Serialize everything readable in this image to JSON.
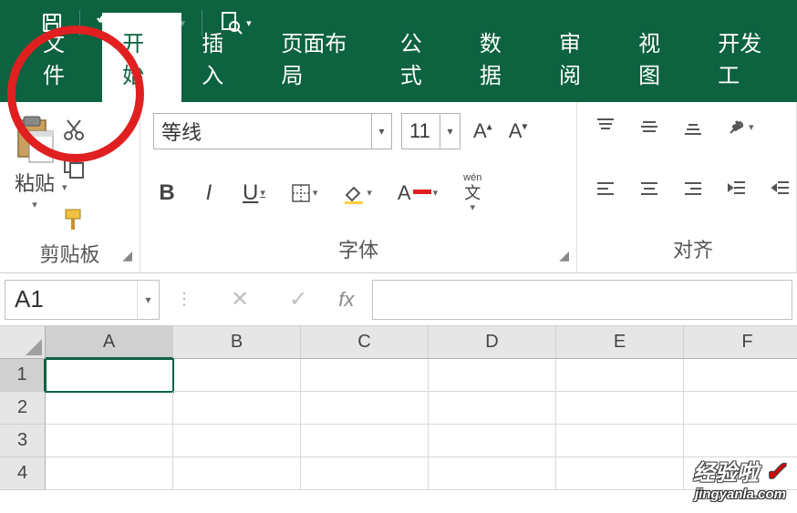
{
  "qat": {
    "save_icon": "save-icon",
    "undo_icon": "undo-icon",
    "redo_icon": "redo-icon",
    "preview_icon": "preview-icon"
  },
  "tabs": {
    "file": "文件",
    "home": "开始",
    "insert": "插入",
    "layout": "页面布局",
    "formula": "公式",
    "data": "数据",
    "review": "审阅",
    "view": "视图",
    "developer": "开发工",
    "active": "home"
  },
  "ribbon": {
    "clipboard": {
      "paste": "粘贴",
      "label": "剪贴板"
    },
    "font": {
      "name": "等线",
      "size": "11",
      "bold": "B",
      "italic": "I",
      "underline": "U",
      "wen": "wén",
      "wen2": "文",
      "label": "字体"
    },
    "align": {
      "label": "对齐"
    }
  },
  "name_box": "A1",
  "fx": "fx",
  "columns": [
    "A",
    "B",
    "C",
    "D",
    "E",
    "F"
  ],
  "rows": [
    "1",
    "2",
    "3",
    "4"
  ],
  "selected_cell": "A1",
  "watermark": {
    "title": "经验啦",
    "url": "jingyanla.com"
  }
}
